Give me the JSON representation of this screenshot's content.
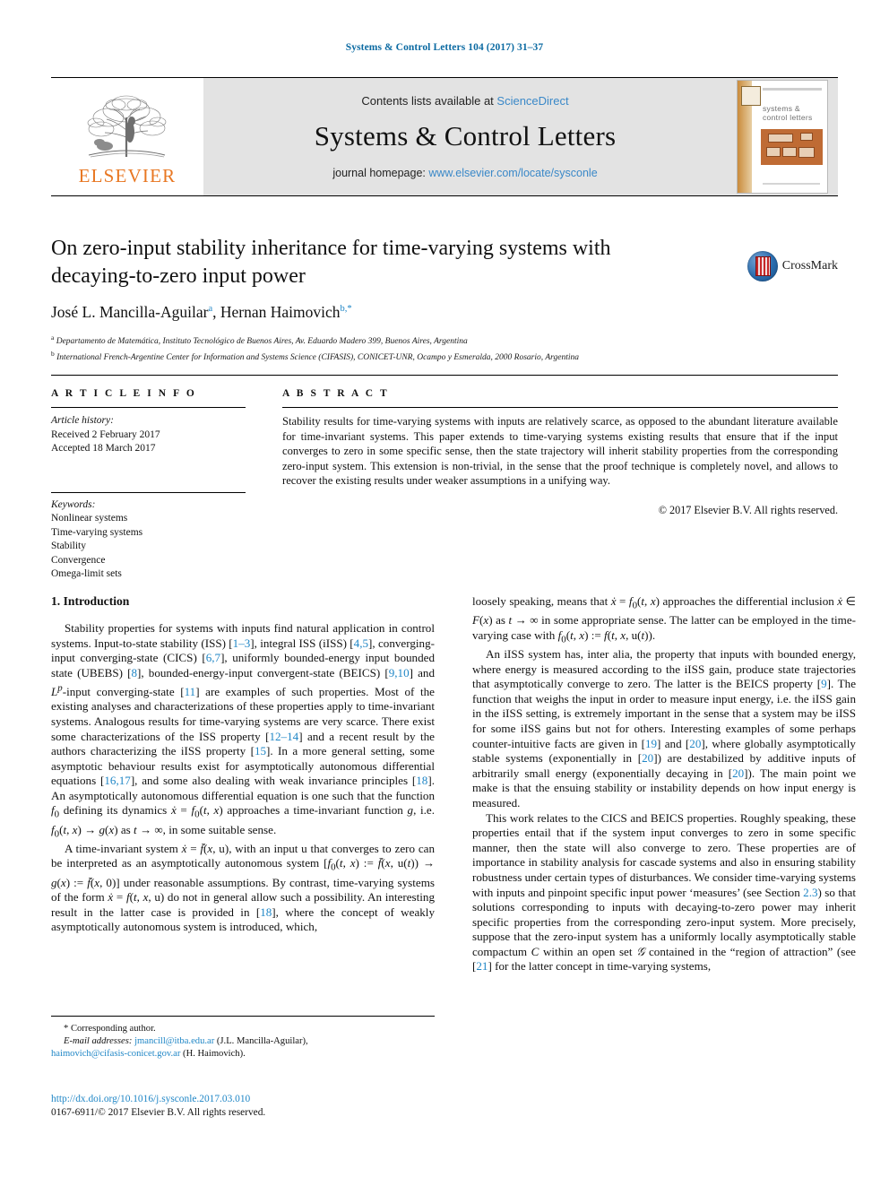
{
  "running_head": "Systems & Control Letters 104 (2017) 31–37",
  "masthead": {
    "contents_prefix": "Contents lists available at ",
    "contents_link": "ScienceDirect",
    "journal_name": "Systems & Control Letters",
    "homepage_prefix": "journal homepage: ",
    "homepage_link": "www.elsevier.com/locate/sysconle",
    "publisher_logo_text": "ELSEVIER",
    "cover_title_line1": "systems &",
    "cover_title_line2": "control letters"
  },
  "article": {
    "title": "On zero-input stability inheritance for time-varying systems with decaying-to-zero input power",
    "authors_html": "José L. Mancilla-Aguilar <sup>a</sup>, Hernan Haimovich <sup>b,*</sup>",
    "author1": "José L. Mancilla-Aguilar",
    "author1_mark": "a",
    "author2": "Hernan Haimovich",
    "author2_mark": "b,*",
    "affiliation_a": "Departamento de Matemática, Instituto Tecnológico de Buenos Aires, Av. Eduardo Madero 399, Buenos Aires, Argentina",
    "affiliation_a_mark": "a",
    "affiliation_b": "International French-Argentine Center for Information and Systems Science (CIFASIS), CONICET-UNR, Ocampo y Esmeralda, 2000 Rosario, Argentina",
    "affiliation_b_mark": "b",
    "crossmark_label": "CrossMark"
  },
  "article_info": {
    "heading": "A R T I C L E   I N F O",
    "history_label": "Article history:",
    "received": "Received 2 February 2017",
    "accepted": "Accepted 18 March 2017",
    "keywords_label": "Keywords:",
    "keywords": [
      "Nonlinear systems",
      "Time-varying systems",
      "Stability",
      "Convergence",
      "Omega-limit sets"
    ]
  },
  "abstract": {
    "heading": "A B S T R A C T",
    "text": "Stability results for time-varying systems with inputs are relatively scarce, as opposed to the abundant literature available for time-invariant systems. This paper extends to time-varying systems existing results that ensure that if the input converges to zero in some specific sense, then the state trajectory will inherit stability properties from the corresponding zero-input system. This extension is non-trivial, in the sense that the proof technique is completely novel, and allows to recover the existing results under weaker assumptions in a unifying way.",
    "copyright": "© 2017 Elsevier B.V. All rights reserved."
  },
  "body": {
    "section_heading": "1. Introduction",
    "left_paragraphs": [
      "Stability properties for systems with inputs find natural application in control systems. Input-to-state stability (ISS) [1–3], integral ISS (iISS) [4,5], converging-input converging-state (CICS) [6,7], uniformly bounded-energy input bounded state (UBEBS) [8], bounded-energy-input convergent-state (BEICS) [9,10] and L^p-input converging-state [11] are examples of such properties. Most of the existing analyses and characterizations of these properties apply to time-invariant systems. Analogous results for time-varying systems are very scarce. There exist some characterizations of the ISS property [12–14] and a recent result by the authors characterizing the iISS property [15]. In a more general setting, some asymptotic behaviour results exist for asymptotically autonomous differential equations [16,17], and some also dealing with weak invariance principles [18]. An asymptotically autonomous differential equation is one such that the function f0 defining its dynamics ẋ = f0(t, x) approaches a time-invariant function g, i.e. f0(t, x) → g(x) as t → ∞, in some suitable sense.",
      "A time-invariant system ẋ = f̄(x, u), with an input u that converges to zero can be interpreted as an asymptotically autonomous system [f0(t, x) := f̄(x, u(t)) → g(x) := f̄(x, 0)] under reasonable assumptions. By contrast, time-varying systems of the form ẋ = f(t, x, u) do not in general allow such a possibility. An interesting result in the latter case is provided in [18], where the concept of weakly asymptotically autonomous system is introduced, which,"
    ],
    "right_paragraphs": [
      "loosely speaking, means that ẋ = f0(t, x) approaches the differential inclusion ẋ ∈ F(x) as t → ∞ in some appropriate sense. The latter can be employed in the time-varying case with f0(t, x) := f(t, x, u(t)).",
      "An iISS system has, inter alia, the property that inputs with bounded energy, where energy is measured according to the iISS gain, produce state trajectories that asymptotically converge to zero. The latter is the BEICS property [9]. The function that weighs the input in order to measure input energy, i.e. the iISS gain in the iISS setting, is extremely important in the sense that a system may be iISS for some iISS gains but not for others. Interesting examples of some perhaps counter-intuitive facts are given in [19] and [20], where globally asymptotically stable systems (exponentially in [20]) are destabilized by additive inputs of arbitrarily small energy (exponentially decaying in [20]). The main point we make is that the ensuing stability or instability depends on how input energy is measured.",
      "This work relates to the CICS and BEICS properties. Roughly speaking, these properties entail that if the system input converges to zero in some specific manner, then the state will also converge to zero. These properties are of importance in stability analysis for cascade systems and also in ensuring stability robustness under certain types of disturbances. We consider time-varying systems with inputs and pinpoint specific input power 'measures' (see Section 2.3) so that solutions corresponding to inputs with decaying-to-zero power may inherit specific properties from the corresponding zero-input system. More precisely, suppose that the zero-input system has a uniformly locally asymptotically stable compactum C within an open set G contained in the \"region of attraction\" (see [21] for the latter concept in time-varying systems,"
    ]
  },
  "footnote": {
    "corresponding_author": "* Corresponding author.",
    "email_label": "E-mail addresses:",
    "email1": "jmancill@itba.edu.ar",
    "email1_owner": "(J.L. Mancilla-Aguilar),",
    "email2": "haimovich@cifasis-conicet.gov.ar",
    "email2_owner": "(H. Haimovich).",
    "doi": "http://dx.doi.org/10.1016/j.sysconle.2017.03.010",
    "issn_line": "0167-6911/© 2017 Elsevier B.V. All rights reserved."
  },
  "colors": {
    "link_blue": "#1f86c6",
    "header_blue": "#0b6aa2",
    "elsevier_orange": "#e87722",
    "masthead_gray": "#e3e3e3"
  }
}
